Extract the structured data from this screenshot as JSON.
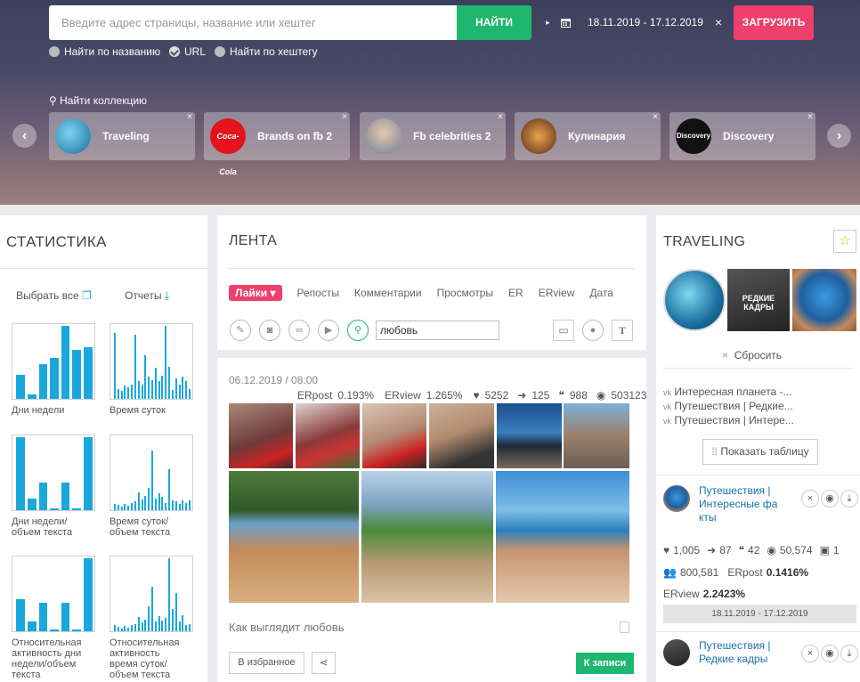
{
  "search": {
    "placeholder": "Введите адрес страницы, название или хештег",
    "button": "НАЙТИ",
    "date_range": "18.11.2019 - 17.12.2019",
    "clear": "×",
    "load_button": "ЗАГРУЗИТЬ"
  },
  "search_options": [
    {
      "label": "Найти по названию",
      "checked": false
    },
    {
      "label": "URL",
      "checked": true
    },
    {
      "label": "Найти по хештегу",
      "checked": false
    }
  ],
  "find_collection": "Найти коллекцию",
  "collections": [
    {
      "name": "Traveling",
      "color": "#2a8fbf"
    },
    {
      "name": "Brands on fb 2",
      "color": "#e3141e"
    },
    {
      "name": "Fb celebrities 2",
      "color": "#8aa0b8"
    },
    {
      "name": "Кулинария",
      "color": "#c0603a"
    },
    {
      "name": "Discovery",
      "color": "#111111"
    }
  ],
  "stats": {
    "title": "СТАТИСТИКА",
    "select_all": "Выбрать все",
    "reports": "Отчеты",
    "charts": [
      {
        "label": "Дни недели",
        "values": [
          0.33,
          0.06,
          0.48,
          0.56,
          1.0,
          0.67,
          0.71
        ]
      },
      {
        "label": "Время суток",
        "values": [
          0.9,
          0.14,
          0.11,
          0.18,
          0.16,
          0.19,
          0.88,
          0.24,
          0.19,
          0.6,
          0.3,
          0.26,
          0.43,
          0.25,
          0.32,
          1.0,
          0.44,
          0.12,
          0.28,
          0.2,
          0.3,
          0.24,
          0.14
        ]
      },
      {
        "label": "Дни недели/\nобъем текста",
        "values": [
          1.0,
          0.16,
          0.38,
          0.02,
          0.38,
          0.02,
          1.0
        ]
      },
      {
        "label": "Время суток/\nобъем текста",
        "values": [
          0.09,
          0.07,
          0.05,
          0.08,
          0.06,
          0.1,
          0.12,
          0.24,
          0.15,
          0.2,
          0.3,
          0.82,
          0.16,
          0.23,
          0.18,
          0.1,
          0.56,
          0.14,
          0.12,
          0.08,
          0.14,
          0.1,
          0.13
        ]
      },
      {
        "label": "Относительная\nактивность дни\nнедели/объем\nтекста",
        "values": [
          0.44,
          0.14,
          0.39,
          0.02,
          0.39,
          0.02,
          1.0
        ]
      },
      {
        "label": "Относительная\nактивность\nвремя суток/\nобъем текста",
        "values": [
          0.08,
          0.06,
          0.04,
          0.07,
          0.05,
          0.09,
          0.1,
          0.2,
          0.12,
          0.16,
          0.34,
          0.61,
          0.14,
          0.21,
          0.15,
          0.18,
          1.0,
          0.3,
          0.52,
          0.14,
          0.22,
          0.08,
          0.1
        ]
      }
    ]
  },
  "feed": {
    "title": "ЛЕНТА",
    "tabs": [
      "Лайки",
      "Репосты",
      "Комментарии",
      "Просмотры",
      "ER",
      "ERview",
      "Дата"
    ],
    "filter_value": "любовь",
    "post": {
      "datetime": "06.12.2019 / 08:00",
      "erpost_label": "ERpost",
      "erpost": "0.193%",
      "erview_label": "ERview",
      "erview": "1.265%",
      "likes": "5252",
      "reposts": "125",
      "comments": "988",
      "views": "503123",
      "caption": "Как выглядит любовь",
      "favorite": "В избранное",
      "to_post": "К записи"
    }
  },
  "traveling": {
    "title": "TRAVELING",
    "reset": "Сбросить",
    "pages": [
      "Интересная планета -...",
      "Путешествия | Редкие...",
      "Путешествия | Интере..."
    ],
    "show_table": "Показать таблицу",
    "items": [
      {
        "name": "Путешествия | Интересные фа кты",
        "likes": "1,005",
        "reposts": "87",
        "comments": "42",
        "views": "50,574",
        "posts": "1",
        "subscribers": "800,581",
        "erpost_label": "ERpost",
        "erpost": "0.1416%",
        "erview_label": "ERview",
        "erview": "2.2423%",
        "date_range": "18.11.2019 - 17.12.2019"
      },
      {
        "name": "Путешествия | Редкие кадры"
      }
    ]
  },
  "colors": {
    "accent_green": "#1fb76f",
    "accent_pink": "#ee3f6d",
    "bar_blue": "#1aa8dc"
  }
}
